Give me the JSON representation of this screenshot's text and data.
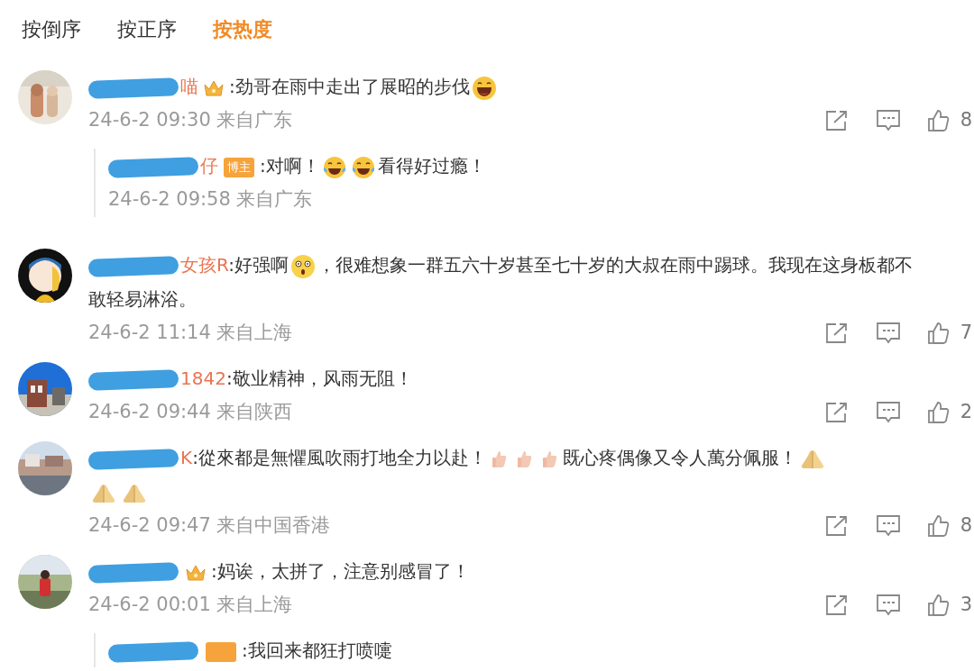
{
  "sort_tabs": [
    {
      "label": "按倒序",
      "selected": false
    },
    {
      "label": "按正序",
      "selected": false
    },
    {
      "label": "按热度",
      "selected": true
    }
  ],
  "comments": [
    {
      "redacted": true,
      "name": "喵",
      "badge": {
        "kind": "crown"
      },
      "content": [
        {
          "kind": "text",
          "text": ":劲哥在雨中走出了展昭的步伐"
        },
        {
          "kind": "grin"
        }
      ],
      "time": "24-6-2 09:30 来自广东",
      "likes": "8",
      "replies": [
        {
          "redacted": true,
          "name": "仔",
          "badge": {
            "kind": "label",
            "label": "博主"
          },
          "content": [
            {
              "kind": "text",
              "text": ":对啊！"
            },
            {
              "kind": "tears-laugh"
            },
            {
              "kind": "tears-laugh"
            },
            {
              "kind": "text",
              "text": "看得好过瘾！"
            }
          ],
          "time": "24-6-2 09:58 来自广东"
        }
      ]
    },
    {
      "redacted": true,
      "name": "女孩R",
      "content": [
        {
          "kind": "text",
          "text": ":好强啊"
        },
        {
          "kind": "shocked"
        },
        {
          "kind": "text",
          "text": "，很难想象一群五六十岁甚至七十岁的大叔在雨中踢球。我现在这身板都不"
        },
        {
          "kind": "text",
          "text": "敢轻易淋浴。",
          "newline": true
        }
      ],
      "time": "24-6-2 11:14 来自上海",
      "likes": "7"
    },
    {
      "redacted": true,
      "name": "1842",
      "content": [
        {
          "kind": "text",
          "text": ":敬业精神，风雨无阻！"
        }
      ],
      "time": "24-6-2 09:44 来自陕西",
      "likes": "2"
    },
    {
      "redacted": true,
      "name": "K",
      "content": [
        {
          "kind": "text",
          "text": ":從來都是無懼風吹雨打地全力以赴！"
        },
        {
          "kind": "thumb"
        },
        {
          "kind": "thumb"
        },
        {
          "kind": "thumb"
        },
        {
          "kind": "text",
          "text": "既心疼偶像又令人萬分佩服！"
        },
        {
          "kind": "pray"
        },
        {
          "kind": "pray",
          "newline": true
        },
        {
          "kind": "pray"
        }
      ],
      "time": "24-6-2 09:47 来自中国香港",
      "likes": "8"
    },
    {
      "redacted": true,
      "badge": {
        "kind": "crown"
      },
      "content": [
        {
          "kind": "text",
          "text": ":妈诶，太拼了，注意别感冒了！"
        }
      ],
      "time": "24-6-2 00:01 来自上海",
      "likes": "3",
      "replies": [
        {
          "redacted": true,
          "badge": {
            "kind": "label"
          },
          "content": [
            {
              "kind": "text",
              "text": ":我回来都狂打喷嚏"
            }
          ]
        }
      ]
    }
  ]
}
